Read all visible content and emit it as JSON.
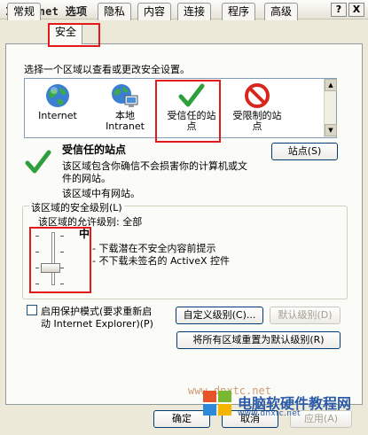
{
  "window": {
    "title": "Internet 选项",
    "help_label": "?",
    "close_label": "X"
  },
  "tabs": [
    {
      "label": "常规"
    },
    {
      "label": "安全"
    },
    {
      "label": "隐私"
    },
    {
      "label": "内容"
    },
    {
      "label": "连接"
    },
    {
      "label": "程序"
    },
    {
      "label": "高级"
    }
  ],
  "active_tab": "安全",
  "security": {
    "instruction": "选择一个区域以查看或更改安全设置。",
    "zones": [
      {
        "icon": "internet-globe-icon",
        "label": "Internet"
      },
      {
        "icon": "local-intranet-icon",
        "label_line1": "本地",
        "label_line2": "Intranet"
      },
      {
        "icon": "trusted-sites-icon",
        "label_line1": "受信任的站",
        "label_line2": "点"
      },
      {
        "icon": "restricted-sites-icon",
        "label_line1": "受限制的站",
        "label_line2": "点"
      }
    ],
    "selected_zone": {
      "title": "受信任的站点",
      "desc_line1": "该区域包含你确信不会损害你的计算机或文",
      "desc_line2": "件的网站。",
      "desc_line3": "该区域中有网站。",
      "sites_button": "站点(S)"
    },
    "level_group": {
      "title": "该区域的安全级别(L)",
      "allowed_text": "该区域的允许级别: 全部",
      "level_name": "中",
      "desc_line1": "- 下载潜在不安全内容前提示",
      "desc_line2": "- 不下载未签名的 ActiveX 控件"
    },
    "protected_mode": {
      "label_line1": "启用保护模式(要求重新启",
      "label_line2": "动 Internet Explorer)(P)",
      "checked": false
    },
    "custom_level_button": "自定义级别(C)...",
    "default_level_button": "默认级别(D)",
    "reset_all_button": "将所有区域重置为默认级别(R)"
  },
  "footer": {
    "ok_label": "确定",
    "cancel_label": "取消",
    "apply_label": "应用(A)"
  },
  "watermark": {
    "url_text": "www.dnxtc.net",
    "brand_text": "电脑软硬件教程网",
    "brand_url": "www.dnxtc.net"
  },
  "colors": {
    "highlight_red": "#e3191b",
    "dialog_bg": "#ece9d8",
    "panel_bg": "#fbfbf8"
  }
}
